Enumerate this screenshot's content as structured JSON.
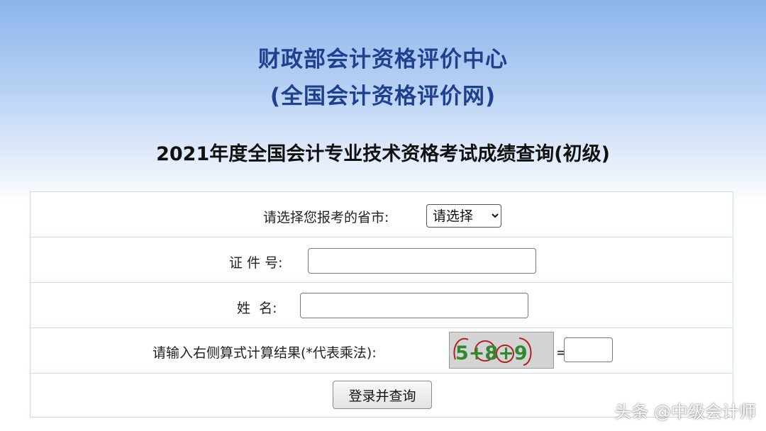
{
  "header": {
    "org_name": "财政部会计资格评价中心",
    "org_subtitle": "(全国会计资格评价网)",
    "exam_title": "2021年度全国会计专业技术资格考试成绩查询(初级)"
  },
  "form": {
    "province": {
      "label": "请选择您报考的省市:",
      "selected": "请选择"
    },
    "id_number": {
      "label": "证 件 号:",
      "value": ""
    },
    "name": {
      "label": "姓  名:",
      "value": ""
    },
    "captcha": {
      "label": "请输入右侧算式计算结果(*代表乘法):",
      "image_text": "5+8+9",
      "equals": "=",
      "answer": ""
    },
    "submit_label": "登录并查询"
  },
  "watermark": "头条 @中级会计师",
  "colors": {
    "title_blue": "#1f3f8f",
    "border": "#c9d9ee",
    "captcha_red": "#b32020",
    "captcha_green": "#2f8a2f"
  }
}
